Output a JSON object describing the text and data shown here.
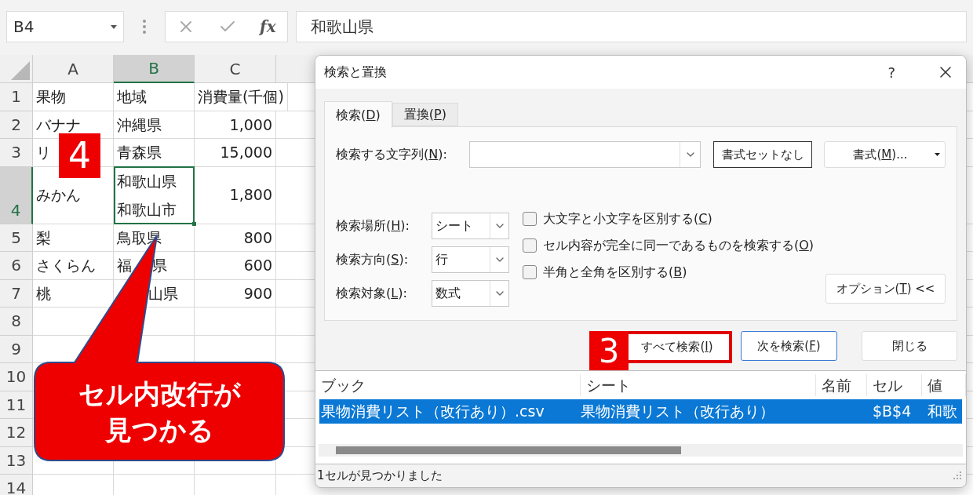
{
  "formula_bar": {
    "name_box": "B4",
    "function_label": "fx",
    "formula": "和歌山県"
  },
  "sheet": {
    "columns": [
      {
        "label": "A",
        "selected": false
      },
      {
        "label": "B",
        "selected": true
      },
      {
        "label": "C",
        "selected": false
      }
    ],
    "rows": [
      {
        "number": "1",
        "selected": false,
        "cells": [
          {
            "kind": "text",
            "text": "果物",
            "selected": false
          },
          {
            "kind": "text",
            "text": "地域",
            "selected": false
          },
          {
            "kind": "text",
            "text": "消費量(千個)",
            "selected": false
          }
        ]
      },
      {
        "number": "2",
        "selected": false,
        "cells": [
          {
            "kind": "text",
            "text": "バナナ",
            "selected": false
          },
          {
            "kind": "text",
            "text": "沖縄県",
            "selected": false
          },
          {
            "kind": "number",
            "text": "1,000",
            "selected": false
          }
        ]
      },
      {
        "number": "3",
        "selected": false,
        "cells": [
          {
            "kind": "text",
            "text": "リ",
            "selected": false
          },
          {
            "kind": "text",
            "text": "青森県",
            "selected": false
          },
          {
            "kind": "number",
            "text": "15,000",
            "selected": false
          }
        ]
      },
      {
        "number": "4",
        "selected": true,
        "cells": [
          {
            "kind": "text",
            "text": "みかん",
            "selected": false
          },
          {
            "kind": "lines",
            "lines": [
              "和歌山県",
              "和歌山市"
            ],
            "selected": true
          },
          {
            "kind": "number",
            "text": "1,800",
            "selected": false
          }
        ]
      },
      {
        "number": "5",
        "selected": false,
        "cells": [
          {
            "kind": "text",
            "text": "梨",
            "selected": false
          },
          {
            "kind": "text",
            "text": "鳥取県",
            "selected": false
          },
          {
            "kind": "number",
            "text": "800",
            "selected": false
          }
        ]
      },
      {
        "number": "6",
        "selected": false,
        "cells": [
          {
            "kind": "text",
            "text": "さくらん",
            "selected": false
          },
          {
            "kind": "split",
            "parts": [
              "福",
              "県"
            ],
            "selected": false
          },
          {
            "kind": "number",
            "text": "600",
            "selected": false
          }
        ]
      },
      {
        "number": "7",
        "selected": false,
        "cells": [
          {
            "kind": "text",
            "text": "桃",
            "selected": false
          },
          {
            "kind": "covered",
            "text": "山県",
            "selected": false
          },
          {
            "kind": "number",
            "text": "900",
            "selected": false
          }
        ]
      },
      {
        "number": "8",
        "selected": false
      },
      {
        "number": "9",
        "selected": false
      },
      {
        "number": "10",
        "selected": false
      },
      {
        "number": "11",
        "selected": false
      },
      {
        "number": "12",
        "selected": false
      },
      {
        "number": "13",
        "selected": false
      },
      {
        "number": "14",
        "selected": false
      }
    ],
    "step_badge": "4"
  },
  "callout": {
    "lines": [
      "セル内改行が",
      "見つかる"
    ]
  },
  "dialog": {
    "title": "検索と置換",
    "help": "?",
    "tabs": [
      {
        "label": "検索(D)",
        "selected": true
      },
      {
        "label": "置換(P)",
        "selected": false
      }
    ],
    "find_label": "検索する文字列(N):",
    "format_none_button": "書式セットなし",
    "format_button": "書式(M)...",
    "options": [
      {
        "label": "検索場所(H):",
        "value": "シート"
      },
      {
        "label": "検索方向(S):",
        "value": "行"
      },
      {
        "label": "検索対象(L):",
        "value": "数式"
      }
    ],
    "checkboxes": [
      {
        "label": "大文字と小文字を区別する(C)",
        "checked": false
      },
      {
        "label": "セル内容が完全に同一であるものを検索する(O)",
        "checked": false
      },
      {
        "label": "半角と全角を区別する(B)",
        "checked": false
      }
    ],
    "options_button": "オプション(T) <<",
    "buttons": [
      {
        "label": "すべて検索(I)",
        "kind": "annotated"
      },
      {
        "label": "次を検索(F)",
        "kind": "focused"
      },
      {
        "label": "閉じる",
        "kind": "plain"
      }
    ],
    "step_badge": "3",
    "results": {
      "columns": [
        "ブック",
        "シート",
        "名前",
        "セル",
        "値"
      ],
      "rows": [
        {
          "book": "果物消費リスト（改行あり）.csv",
          "sheet": "果物消費リスト（改行あり）",
          "cell": "$B$4",
          "value": "和歌",
          "selected": true
        }
      ]
    },
    "status": "1セルが見つかりました"
  }
}
